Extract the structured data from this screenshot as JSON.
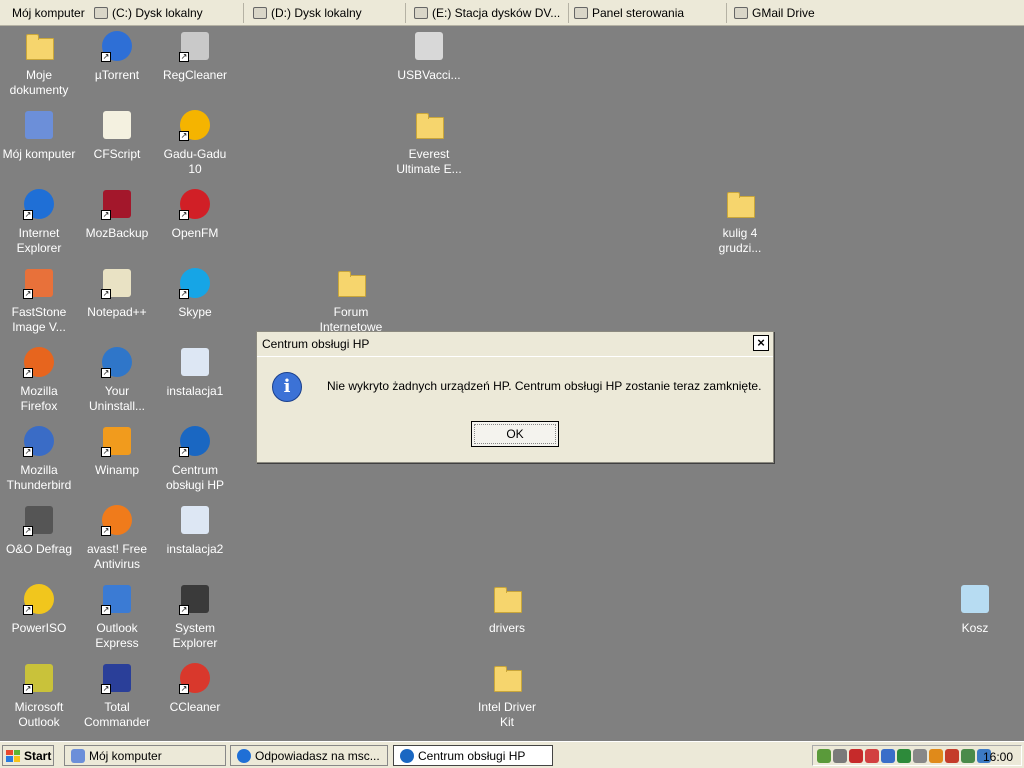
{
  "topbar": {
    "items": [
      {
        "label": "Mój komputer",
        "icon": "computer-icon"
      },
      {
        "label": "(C:) Dysk lokalny",
        "icon": "drive-icon"
      },
      {
        "label": "(D:) Dysk lokalny",
        "icon": "drive-icon"
      },
      {
        "label": "(E:) Stacja dysków DV...",
        "icon": "dvd-drive-icon"
      },
      {
        "label": "Panel sterowania",
        "icon": "control-panel-icon"
      },
      {
        "label": "GMail Drive",
        "icon": "network-drive-icon"
      }
    ]
  },
  "desktop": {
    "icons": [
      {
        "label": "Moje dokumenty",
        "icon": "my-documents-icon",
        "color": "#f6d56d"
      },
      {
        "label": "µTorrent",
        "icon": "utorrent-icon",
        "color": "#2e6fd6"
      },
      {
        "label": "RegCleaner",
        "icon": "regcleaner-icon",
        "color": "#c9c9c9"
      },
      {
        "label": "USBVacci...",
        "icon": "syringe-icon",
        "color": "#d8d8d8"
      },
      {
        "label": "Mój komputer",
        "icon": "my-computer-icon",
        "color": "#6c8fd9"
      },
      {
        "label": "CFScript",
        "icon": "script-icon",
        "color": "#f4f1e0"
      },
      {
        "label": "Gadu-Gadu 10",
        "icon": "gadu-gadu-icon",
        "color": "#f5b400"
      },
      {
        "label": "Everest Ultimate E...",
        "icon": "folder-icon"
      },
      {
        "label": "Internet Explorer",
        "icon": "internet-explorer-icon",
        "color": "#1f6fd6"
      },
      {
        "label": "MozBackup",
        "icon": "mozbackup-icon",
        "color": "#a3172b"
      },
      {
        "label": "OpenFM",
        "icon": "openfm-icon",
        "color": "#d11f26"
      },
      {
        "label": "kulig 4 grudzi...",
        "icon": "folder-icon"
      },
      {
        "label": "FastStone Image V...",
        "icon": "faststone-icon",
        "color": "#e8713a"
      },
      {
        "label": "Notepad++",
        "icon": "notepadpp-icon",
        "color": "#e9e2c4"
      },
      {
        "label": "Skype",
        "icon": "skype-icon",
        "color": "#16a5e6"
      },
      {
        "label": "Forum Internetowe",
        "icon": "folder-icon"
      },
      {
        "label": "Mozilla Firefox",
        "icon": "firefox-icon",
        "color": "#e7651e"
      },
      {
        "label": "Your Uninstall...",
        "icon": "your-uninstaller-icon",
        "color": "#2f76c9"
      },
      {
        "label": "instalacja1",
        "icon": "window-screenshot-icon",
        "color": "#dde7f4"
      },
      {
        "label": "Mozilla Thunderbird",
        "icon": "thunderbird-icon",
        "color": "#3a6cc6"
      },
      {
        "label": "Winamp",
        "icon": "winamp-icon",
        "color": "#f19b1d"
      },
      {
        "label": "Centrum obsługi HP",
        "icon": "hp-icon",
        "color": "#1a67c2"
      },
      {
        "label": "O&O Defrag",
        "icon": "defrag-icon",
        "color": "#555555"
      },
      {
        "label": "avast! Free Antivirus",
        "icon": "avast-icon",
        "color": "#f07b1b"
      },
      {
        "label": "instalacja2",
        "icon": "window-screenshot-icon",
        "color": "#dde7f4"
      },
      {
        "label": "PowerISO",
        "icon": "poweriso-icon",
        "color": "#f1c61d"
      },
      {
        "label": "Outlook Express",
        "icon": "outlook-express-icon",
        "color": "#3b7bd4"
      },
      {
        "label": "System Explorer",
        "icon": "system-explorer-icon",
        "color": "#3a3a3a"
      },
      {
        "label": "drivers",
        "icon": "folder-icon"
      },
      {
        "label": "Kosz",
        "icon": "recycle-bin-icon",
        "color": "#b7dcf2"
      },
      {
        "label": "Microsoft Outlook",
        "icon": "outlook-icon",
        "color": "#c9c23a"
      },
      {
        "label": "Total Commander",
        "icon": "total-commander-icon",
        "color": "#2a3f99"
      },
      {
        "label": "CCleaner",
        "icon": "ccleaner-icon",
        "color": "#d9382c"
      },
      {
        "label": "Intel Driver Kit",
        "icon": "folder-icon"
      }
    ]
  },
  "dialog": {
    "title": "Centrum obsługi HP",
    "message": "Nie wykryto żadnych urządzeń HP. Centrum obsługi HP zostanie teraz zamknięte.",
    "ok_label": "OK",
    "close_glyph": "×",
    "info_glyph": "i"
  },
  "taskbar": {
    "start_label": "Start",
    "tasks": [
      {
        "label": "Mój komputer",
        "icon": "my-computer-icon",
        "active": false
      },
      {
        "label": "Odpowiadasz na msc...",
        "icon": "internet-explorer-icon",
        "active": false
      },
      {
        "label": "Centrum obsługi HP",
        "icon": "hp-icon",
        "active": true
      }
    ],
    "clock": "16:00"
  }
}
